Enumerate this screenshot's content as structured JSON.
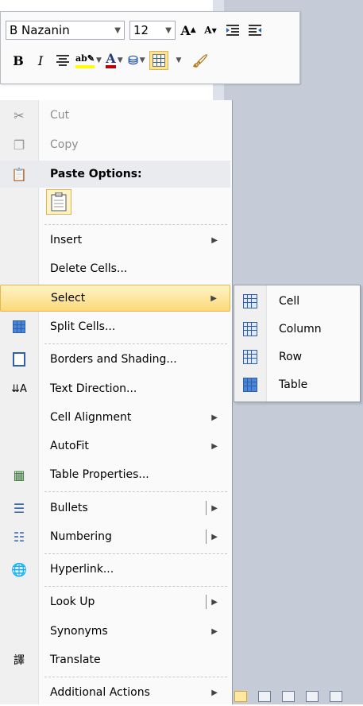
{
  "mini_toolbar": {
    "font_name": "B Nazanin",
    "font_size": "12",
    "grow_font": "A",
    "shrink_font": "A",
    "bold": "B",
    "italic": "I",
    "font_color_letter": "A"
  },
  "menu": {
    "cut": "Cut",
    "copy": "Copy",
    "paste_options": "Paste Options:",
    "insert": "Insert",
    "delete_cells": "Delete Cells...",
    "select": "Select",
    "split_cells": "Split Cells...",
    "borders_shading": "Borders and Shading...",
    "text_direction": "Text Direction...",
    "cell_alignment": "Cell Alignment",
    "autofit": "AutoFit",
    "table_properties": "Table Properties...",
    "bullets": "Bullets",
    "numbering": "Numbering",
    "hyperlink": "Hyperlink...",
    "look_up": "Look Up",
    "synonyms": "Synonyms",
    "translate": "Translate",
    "additional_actions": "Additional Actions"
  },
  "submenu": {
    "cell": "Cell",
    "column": "Column",
    "row": "Row",
    "table": "Table"
  },
  "colors": {
    "highlight": "#ffff00",
    "font_color": "#c00000",
    "hover": "#fbd97a",
    "table_icon": "#2f5fa8"
  }
}
